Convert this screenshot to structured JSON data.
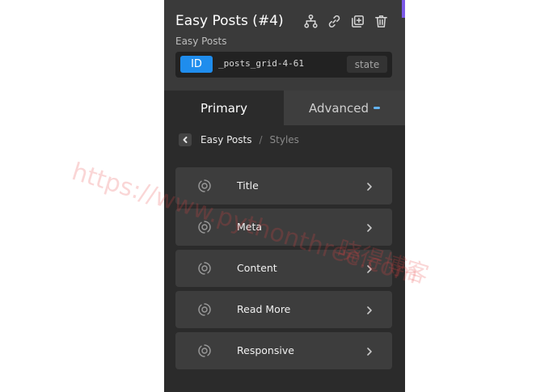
{
  "header": {
    "title": "Easy Posts (#4)",
    "subtitle": "Easy Posts",
    "icons": [
      "hierarchy-icon",
      "link-icon",
      "duplicate-icon",
      "trash-icon"
    ],
    "id_badge": "ID",
    "id_value": "_posts_grid-4-61",
    "state_label": "state"
  },
  "tabs": [
    {
      "label": "Primary",
      "active": true
    },
    {
      "label": "Advanced",
      "active": false
    }
  ],
  "breadcrumb": {
    "current": "Easy Posts",
    "separator": "/",
    "child": "Styles"
  },
  "items": [
    {
      "label": "Title"
    },
    {
      "label": "Meta"
    },
    {
      "label": "Content"
    },
    {
      "label": "Read More"
    },
    {
      "label": "Responsive"
    }
  ],
  "watermark": {
    "url": "https://www.pythonthree.com",
    "text": "晓得博客"
  },
  "colors": {
    "panel_bg": "#2b2b2b",
    "header_bg": "#3a3a3a",
    "id_badge_bg": "#1f8ded",
    "accent_purple": "#7b59e6",
    "item_bg": "#3d3d3d"
  }
}
